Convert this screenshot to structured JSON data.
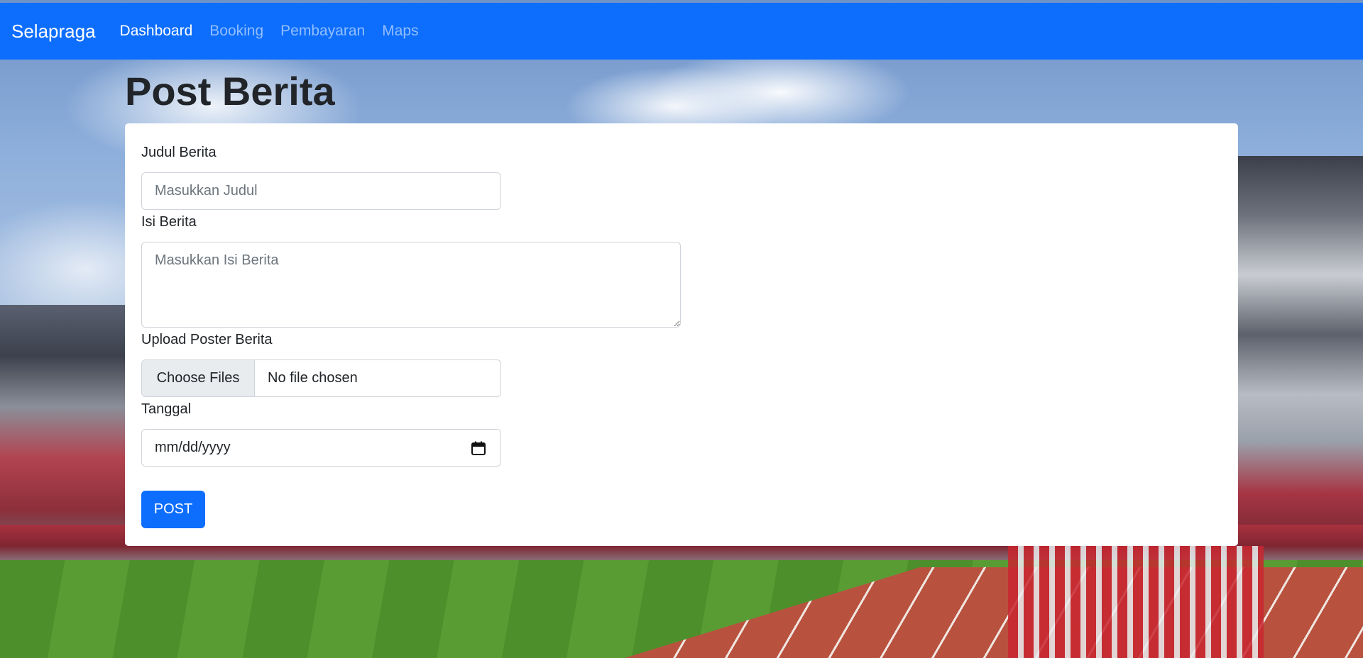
{
  "navbar": {
    "brand": "Selapraga",
    "links": [
      {
        "label": "Dashboard",
        "active": true
      },
      {
        "label": "Booking",
        "active": false
      },
      {
        "label": "Pembayaran",
        "active": false
      },
      {
        "label": "Maps",
        "active": false
      }
    ]
  },
  "page": {
    "title": "Post Berita"
  },
  "form": {
    "judul": {
      "label": "Judul Berita",
      "placeholder": "Masukkan Judul"
    },
    "isi": {
      "label": "Isi Berita",
      "placeholder": "Masukkan Isi Berita"
    },
    "upload": {
      "label": "Upload Poster Berita",
      "button": "Choose Files",
      "status": "No file chosen"
    },
    "tanggal": {
      "label": "Tanggal",
      "value": "mm/dd/yyyy",
      "icon": "calendar-icon"
    },
    "submit": "POST"
  },
  "colors": {
    "primary": "#0d6efd",
    "text": "#212529",
    "placeholder": "#6c757d"
  }
}
